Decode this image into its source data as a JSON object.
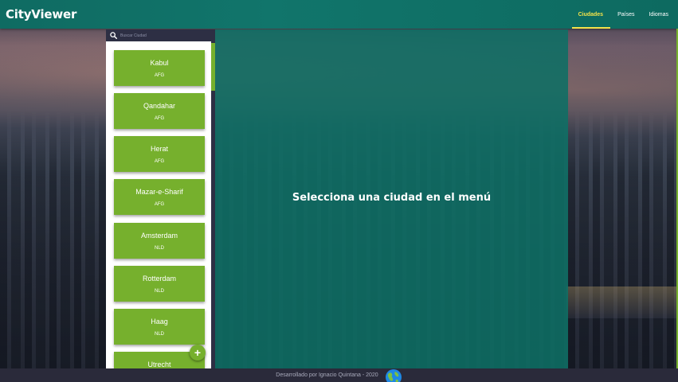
{
  "app": {
    "title": "CityViewer"
  },
  "nav": [
    {
      "label": "Ciudades",
      "active": true
    },
    {
      "label": "Países",
      "active": false
    },
    {
      "label": "Idiomas",
      "active": false
    }
  ],
  "search": {
    "placeholder": "Buscar Ciudad",
    "value": ""
  },
  "cities": [
    {
      "name": "Kabul",
      "code": "AFG"
    },
    {
      "name": "Qandahar",
      "code": "AFG"
    },
    {
      "name": "Herat",
      "code": "AFG"
    },
    {
      "name": "Mazar-e-Sharif",
      "code": "AFG"
    },
    {
      "name": "Amsterdam",
      "code": "NLD"
    },
    {
      "name": "Rotterdam",
      "code": "NLD"
    },
    {
      "name": "Haag",
      "code": "NLD"
    },
    {
      "name": "Utrecht",
      "code": ""
    }
  ],
  "add_button": {
    "label": "+"
  },
  "main": {
    "message": "Selecciona una ciudad en el menú"
  },
  "footer": {
    "text": "Desarrollado por Ignacio Quintana - 2020"
  },
  "colors": {
    "accent": "#76b02d",
    "header": "#11756b",
    "active_nav": "#f3e24a",
    "sidebar_dark": "#2d2f44"
  },
  "icons": {
    "search": "search-icon",
    "globe": "globe-icon"
  }
}
